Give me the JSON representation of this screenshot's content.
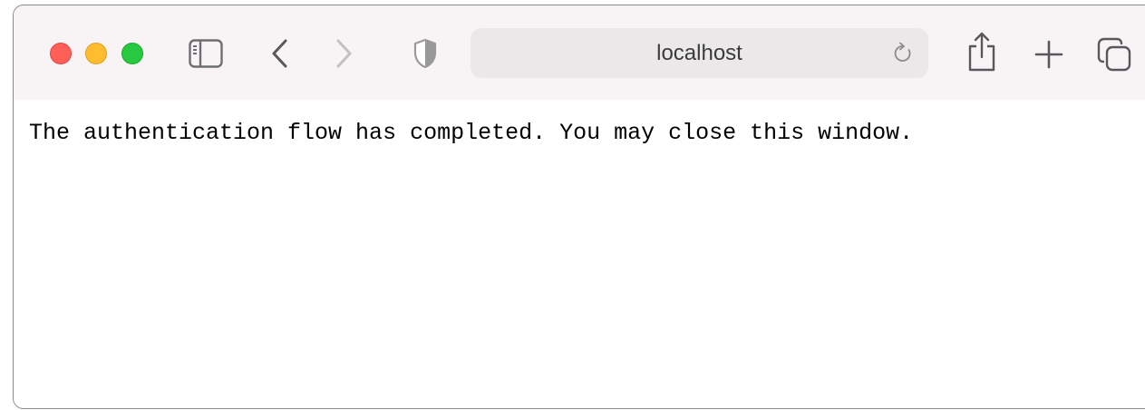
{
  "window": {
    "traffic_lights": {
      "close_color": "#fe5f57",
      "minimize_color": "#febc2e",
      "maximize_color": "#28c840"
    }
  },
  "toolbar": {
    "icons": [
      "sidebar-icon",
      "back-chevron-icon",
      "forward-chevron-icon",
      "privacy-shield-icon",
      "reload-icon",
      "share-icon",
      "plus-icon",
      "tab-overview-icon"
    ],
    "address_bar": {
      "text": "localhost"
    }
  },
  "page": {
    "message": "The authentication flow has completed. You may close this window."
  }
}
